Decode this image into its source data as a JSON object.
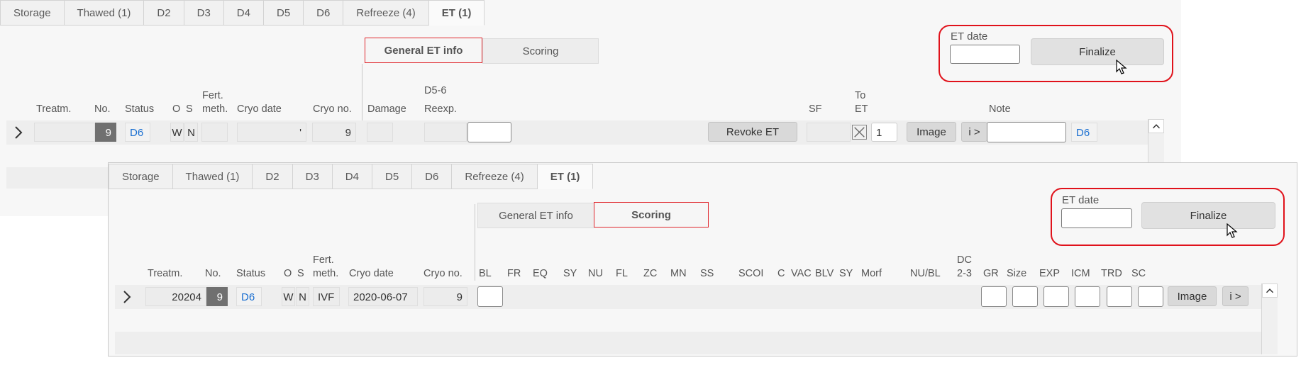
{
  "tabs": [
    "Storage",
    "Thawed (1)",
    "D2",
    "D3",
    "D4",
    "D5",
    "D6",
    "Refreeze (4)",
    "ET (1)"
  ],
  "active_tab": "ET (1)",
  "segments": {
    "general": "General ET info",
    "scoring": "Scoring"
  },
  "et_date_label": "ET date",
  "finalize_label": "Finalize",
  "window1": {
    "headers": {
      "treatm": "Treatm.",
      "no": "No.",
      "status": "Status",
      "o": "O",
      "s": "S",
      "fert_line1": "Fert.",
      "fert_line2": "meth.",
      "cryo_date": "Cryo date",
      "cryo_no": "Cryo no.",
      "damage": "Damage",
      "d56_line1": "D5-6",
      "d56_line2": "Reexp.",
      "sf": "SF",
      "to_et_line1": "To",
      "to_et_line2": "ET",
      "note": "Note"
    },
    "row": {
      "no": "9",
      "status": "D6",
      "o": "W",
      "s": "N",
      "cryo_date": "'",
      "cryo_no": "9",
      "revoke_label": "Revoke ET",
      "to_et_value": "1",
      "image_label": "Image",
      "info_label": "i >",
      "tail_status": "D6"
    }
  },
  "window2": {
    "headers": {
      "treatm": "Treatm.",
      "no": "No.",
      "status": "Status",
      "o": "O",
      "s": "S",
      "fert_line1": "Fert.",
      "fert_line2": "meth.",
      "cryo_date": "Cryo date",
      "cryo_no": "Cryo no.",
      "bl": "BL",
      "fr": "FR",
      "eq": "EQ",
      "sy": "SY",
      "nu": "NU",
      "fl": "FL",
      "zc": "ZC",
      "mn": "MN",
      "ss": "SS",
      "scoi": "SCOI",
      "c": "C",
      "vac": "VAC",
      "blv": "BLV",
      "sy2": "SY",
      "morf": "Morf",
      "nubl": "NU/BL",
      "dc_line1": "DC",
      "dc_line2": "2-3",
      "gr": "GR",
      "size": "Size",
      "exp": "EXP",
      "icm": "ICM",
      "trd": "TRD",
      "sc": "SC"
    },
    "row": {
      "treatm": "20204",
      "no": "9",
      "status": "D6",
      "o": "W",
      "s": "N",
      "fert": "IVF",
      "cryo_date": "2020-06-07",
      "cryo_no": "9",
      "image_label": "Image",
      "info_label": "i >"
    }
  },
  "colors": {
    "highlight": "#e0121b",
    "link": "#1a6fd1"
  },
  "icons": [
    "chevron-right-icon",
    "chevron-up-icon",
    "mouse-cursor-icon",
    "checkbox-x-icon"
  ]
}
